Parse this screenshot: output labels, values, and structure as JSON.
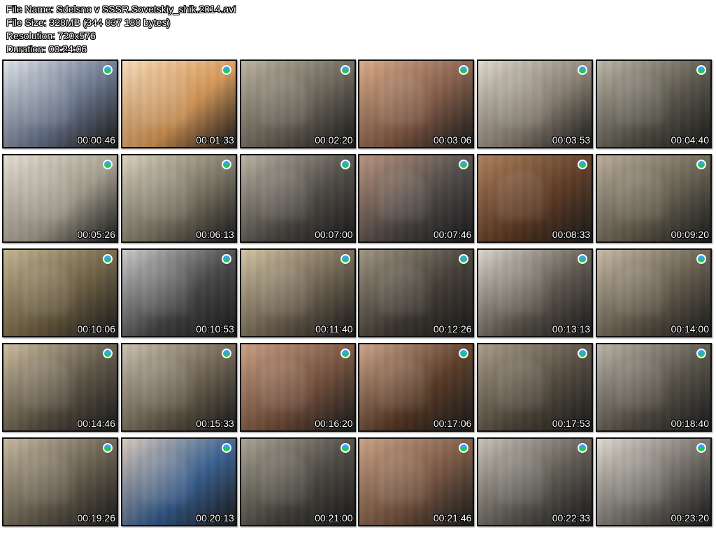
{
  "metadata": {
    "file_name_line": "File Name: Sdelsno v SSSR.Sovetskiy_shik.2014.avi",
    "file_size_line": "File Size: 328MB (344 037 180 bytes)",
    "resolution_line": "Resolution: 720x576",
    "duration_line": "Duration: 00:24:06"
  },
  "thumbnails": [
    {
      "time": "00:00:46",
      "tone": "#6b7790",
      "tone2": "#dde3ea"
    },
    {
      "time": "00:01:33",
      "tone": "#dc9a56",
      "tone2": "#f6d9b5"
    },
    {
      "time": "00:02:20",
      "tone": "#6a6458",
      "tone2": "#b9b09d"
    },
    {
      "time": "00:03:06",
      "tone": "#865c46",
      "tone2": "#d8a883"
    },
    {
      "time": "00:03:53",
      "tone": "#8d8375",
      "tone2": "#ddd6ca"
    },
    {
      "time": "00:04:40",
      "tone": "#5a564a",
      "tone2": "#b8b3a4"
    },
    {
      "time": "00:05:26",
      "tone": "#a8a291",
      "tone2": "#e3ddd0"
    },
    {
      "time": "00:06:13",
      "tone": "#7d7664",
      "tone2": "#d8d0bb"
    },
    {
      "time": "00:07:00",
      "tone": "#4f4b45",
      "tone2": "#b7b0a0"
    },
    {
      "time": "00:07:46",
      "tone": "#4c4745",
      "tone2": "#b78f78"
    },
    {
      "time": "00:08:33",
      "tone": "#5e3921",
      "tone2": "#aa7a54"
    },
    {
      "time": "00:09:20",
      "tone": "#67614f",
      "tone2": "#b8aa97"
    },
    {
      "time": "00:10:06",
      "tone": "#6f6042",
      "tone2": "#c1b28c"
    },
    {
      "time": "00:10:53",
      "tone": "#454545",
      "tone2": "#c8c8c8"
    },
    {
      "time": "00:11:40",
      "tone": "#6f624f",
      "tone2": "#d0c1a0"
    },
    {
      "time": "00:12:26",
      "tone": "#413b33",
      "tone2": "#9b907c"
    },
    {
      "time": "00:13:13",
      "tone": "#5f584e",
      "tone2": "#d9d4cc"
    },
    {
      "time": "00:14:00",
      "tone": "#655b4b",
      "tone2": "#c5b8a2"
    },
    {
      "time": "00:14:46",
      "tone": "#5d5444",
      "tone2": "#cbbb9a"
    },
    {
      "time": "00:15:33",
      "tone": "#6c604d",
      "tone2": "#c9bfae"
    },
    {
      "time": "00:16:20",
      "tone": "#77503b",
      "tone2": "#c99c7f"
    },
    {
      "time": "00:17:06",
      "tone": "#5a3923",
      "tone2": "#cca286"
    },
    {
      "time": "00:17:53",
      "tone": "#534a3d",
      "tone2": "#a79a84"
    },
    {
      "time": "00:18:40",
      "tone": "#575247",
      "tone2": "#b8b2a5"
    },
    {
      "time": "00:19:26",
      "tone": "#665d4c",
      "tone2": "#c4b69b"
    },
    {
      "time": "00:20:13",
      "tone": "#355f92",
      "tone2": "#d7c6b8"
    },
    {
      "time": "00:21:00",
      "tone": "#4b4740",
      "tone2": "#a5a090"
    },
    {
      "time": "00:21:46",
      "tone": "#7a5640",
      "tone2": "#c79d7f"
    },
    {
      "time": "00:22:33",
      "tone": "#5f5b53",
      "tone2": "#c6c1b6"
    },
    {
      "time": "00:23:20",
      "tone": "#736f67",
      "tone2": "#ddd8cf"
    }
  ]
}
